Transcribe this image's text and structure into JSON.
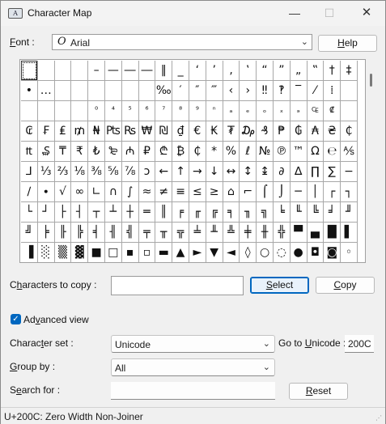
{
  "window": {
    "title": "Character Map",
    "app_icon_text": "A",
    "min_glyph": "—",
    "max_glyph": "☐",
    "close_glyph": "✕"
  },
  "font": {
    "label_mn": "F",
    "label_rest": "ont :",
    "selected_icon_glyph": "O",
    "selected": "Arial",
    "dropdown_glyph": "⌄"
  },
  "help_button": {
    "mn": "H",
    "rest": "elp"
  },
  "grid": {
    "rows": [
      [
        " ",
        " ",
        " ",
        " ",
        "–",
        "—",
        "―",
        "―",
        "‖",
        "_",
        "‘",
        "’",
        "‚",
        "‛",
        "“",
        "”",
        "„",
        "‟",
        "†",
        "‡"
      ],
      [
        "•",
        "…",
        " ",
        " ",
        " ",
        " ",
        " ",
        " ",
        "‰",
        "′",
        "″",
        "‴",
        "‹",
        "›",
        "‼",
        "‽",
        "‾",
        "⁄",
        "⁞",
        " "
      ],
      [
        " ",
        " ",
        " ",
        " ",
        "⁰",
        "⁴",
        "⁵",
        "⁶",
        "⁷",
        "⁸",
        "⁹",
        "ⁿ",
        "ₐ",
        "ₑ",
        "ₒ",
        "ₓ",
        "ₔ",
        "₠",
        "₡",
        " "
      ],
      [
        "₢",
        "₣",
        "₤",
        "₥",
        "₦",
        "₧",
        "₨",
        "₩",
        "₪",
        "₫",
        "€",
        "₭",
        "₮",
        "₯",
        "₰",
        "₱",
        "₲",
        "₳",
        "₴",
        "₵"
      ],
      [
        "₶",
        "₷",
        "₸",
        "₹",
        "₺",
        "₻",
        "₼",
        "₽",
        "₾",
        "₿",
        "₵",
        "*",
        "%",
        "ℓ",
        "№",
        "℗",
        "™",
        "Ω",
        "℮",
        "⅍"
      ],
      [
        "⅃",
        "⅓",
        "⅔",
        "⅛",
        "⅜",
        "⅝",
        "⅞",
        "ↄ",
        "←",
        "↑",
        "→",
        "↓",
        "↔",
        "↕",
        "↨",
        "∂",
        "∆",
        "∏",
        "∑",
        "−"
      ],
      [
        "∕",
        "∙",
        "√",
        "∞",
        "∟",
        "∩",
        "∫",
        "≈",
        "≠",
        "≡",
        "≤",
        "≥",
        "⌂",
        "⌐",
        "⌠",
        "⌡",
        "─",
        "│",
        "┌",
        "┐"
      ],
      [
        "└",
        "┘",
        "├",
        "┤",
        "┬",
        "┴",
        "┼",
        "═",
        "║",
        "╒",
        "╓",
        "╔",
        "╕",
        "╖",
        "╗",
        "╘",
        "╙",
        "╚",
        "╛",
        "╜"
      ],
      [
        "╝",
        "╞",
        "╟",
        "╠",
        "╡",
        "╢",
        "╣",
        "╤",
        "╥",
        "╦",
        "╧",
        "╨",
        "╩",
        "╪",
        "╫",
        "╬",
        "▀",
        "▄",
        "█",
        "▌"
      ],
      [
        "▐",
        "░",
        "▒",
        "▓",
        "■",
        "□",
        "▪",
        "▫",
        "▬",
        "▲",
        "►",
        "▼",
        "◄",
        "◊",
        "○",
        "◌",
        "●",
        "◘",
        "◙",
        "◦"
      ]
    ]
  },
  "copy": {
    "label_pre": "C",
    "label_mn": "h",
    "label_rest": "aracters to copy :",
    "value": "",
    "select_mn": "S",
    "select_rest": "elect",
    "copy_mn": "C",
    "copy_rest": "opy",
    "check_glyph": "✓"
  },
  "advanced": {
    "label_pre": "Ad",
    "label_mn": "v",
    "label_rest": "anced view",
    "checked": true
  },
  "charset": {
    "label_pre": "Charac",
    "label_mn": "t",
    "label_rest": "er set :",
    "value": "Unicode",
    "goto_pre": "Go to ",
    "goto_mn": "U",
    "goto_rest": "nicode :",
    "goto_value": "200C"
  },
  "groupby": {
    "label_pre": "",
    "label_mn": "G",
    "label_rest": "roup by :",
    "value": "All"
  },
  "search": {
    "label_pre": "S",
    "label_mn": "e",
    "label_rest": "arch for :",
    "value": "",
    "reset_mn": "R",
    "reset_rest": "eset"
  },
  "status": {
    "text": "U+200C: Zero Width Non-Joiner",
    "grip_glyph": "⋰"
  }
}
